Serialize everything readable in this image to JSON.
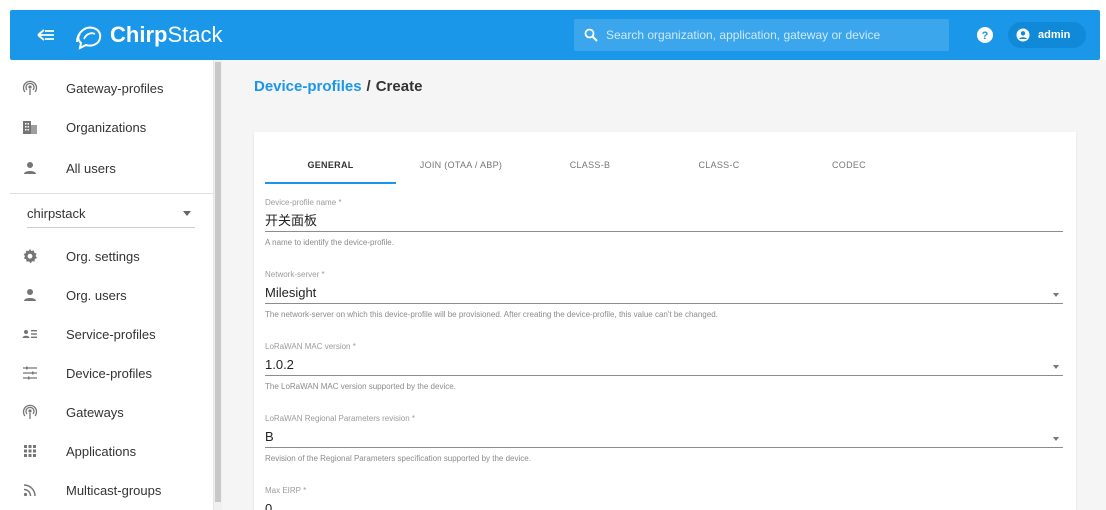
{
  "header": {
    "app_name_bold": "Chirp",
    "app_name_rest": "Stack",
    "search_placeholder": "Search organization, application, gateway or device",
    "user": "admin"
  },
  "sidebar": {
    "top_items": [
      {
        "label": "Gateway-profiles",
        "icon": "gateway-profile-icon"
      },
      {
        "label": "Organizations",
        "icon": "organization-icon"
      },
      {
        "label": "All users",
        "icon": "user-icon"
      }
    ],
    "org_selector": "chirpstack",
    "org_items": [
      {
        "label": "Org. settings",
        "icon": "gear-icon"
      },
      {
        "label": "Org. users",
        "icon": "user-icon"
      },
      {
        "label": "Service-profiles",
        "icon": "service-profile-icon"
      },
      {
        "label": "Device-profiles",
        "icon": "device-profile-icon"
      },
      {
        "label": "Gateways",
        "icon": "gateway-icon"
      },
      {
        "label": "Applications",
        "icon": "apps-grid-icon"
      },
      {
        "label": "Multicast-groups",
        "icon": "rss-icon"
      }
    ]
  },
  "breadcrumb": {
    "parent": "Device-profiles",
    "separator": "/",
    "current": "Create"
  },
  "tabs": [
    "GENERAL",
    "JOIN (OTAA / ABP)",
    "CLASS-B",
    "CLASS-C",
    "CODEC"
  ],
  "active_tab": "GENERAL",
  "form": {
    "name": {
      "label": "Device-profile name *",
      "value": "开关面板",
      "help": "A name to identify the device-profile."
    },
    "network_server": {
      "label": "Network-server *",
      "value": "Milesight",
      "help": "The network-server on which this device-profile will be provisioned. After creating the device-profile, this value can't be changed."
    },
    "mac_version": {
      "label": "LoRaWAN MAC version *",
      "value": "1.0.2",
      "help": "The LoRaWAN MAC version supported by the device."
    },
    "regional_params": {
      "label": "LoRaWAN Regional Parameters revision *",
      "value": "B",
      "help": "Revision of the Regional Parameters specification supported by the device."
    },
    "max_eirp": {
      "label": "Max EIRP *",
      "value": "0"
    }
  },
  "colors": {
    "primary": "#1b97ea",
    "background": "#f5f5f5"
  }
}
